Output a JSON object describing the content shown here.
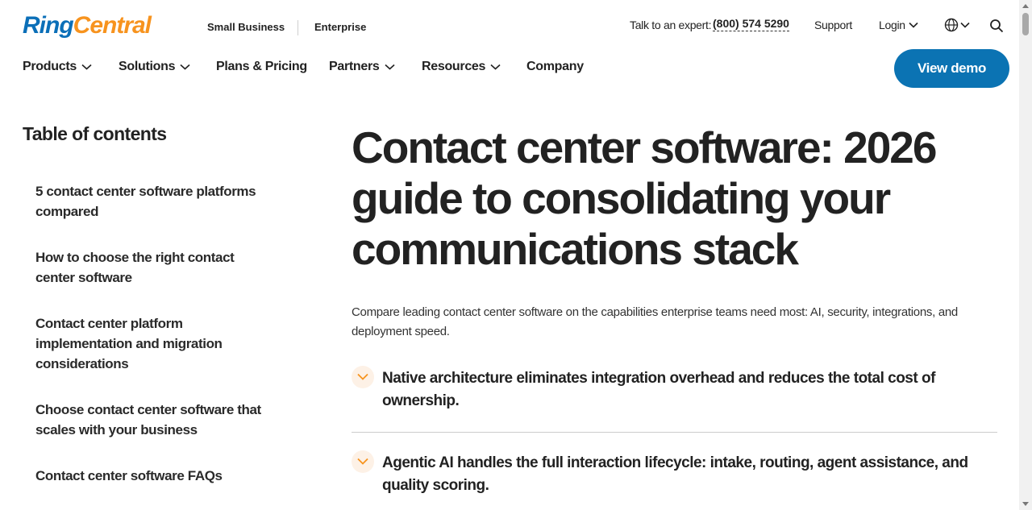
{
  "brand": {
    "part1": "Ring",
    "part2": "Central"
  },
  "segments": {
    "small_business": "Small Business",
    "enterprise": "Enterprise"
  },
  "utility": {
    "talk_label": "Talk to an expert:",
    "phone": "(800) 574 5290",
    "support": "Support",
    "login": "Login"
  },
  "nav": {
    "products": "Products",
    "solutions": "Solutions",
    "plans": "Plans & Pricing",
    "partners": "Partners",
    "resources": "Resources",
    "company": "Company"
  },
  "cta": {
    "view_demo": "View demo"
  },
  "toc": {
    "title": "Table of contents",
    "items": [
      "5 contact center software platforms compared",
      "How to choose the right contact center software",
      "Contact center platform implementation and migration considerations",
      "Choose contact center software that scales with your business",
      "Contact center software FAQs"
    ]
  },
  "article": {
    "title": "Contact center software: 2026 guide to consolidating your communications stack",
    "lead": "Compare leading contact center software on the capabilities enterprise teams need most: AI, security, integrations, and deployment speed.",
    "bullets": [
      "Native architecture eliminates integration overhead and reduces the total cost of ownership.",
      "Agentic AI handles the full interaction lifecycle: intake, routing, agent assistance, and quality scoring."
    ]
  },
  "colors": {
    "brand_blue": "#0b73b3",
    "brand_orange": "#f7931e"
  }
}
